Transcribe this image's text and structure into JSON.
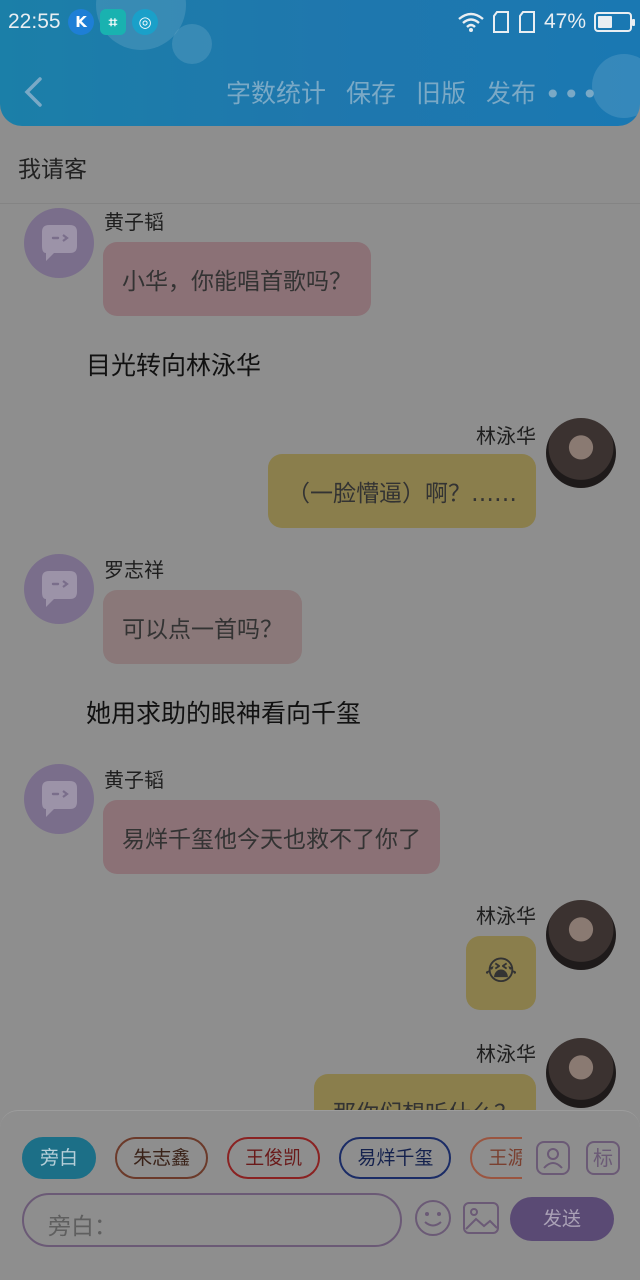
{
  "status_bar": {
    "time": "22:55",
    "battery": "47%",
    "battery_level": 0.47
  },
  "nav": {
    "actions": [
      "字数统计",
      "保存",
      "旧版",
      "发布"
    ],
    "more": "•••"
  },
  "title": "我请客",
  "messages": [
    {
      "type": "left",
      "name": "黄子韬",
      "text": "小华，你能唱首歌吗？",
      "color": "pink"
    },
    {
      "type": "narration",
      "text": "目光转向林泳华"
    },
    {
      "type": "right",
      "name": "林泳华",
      "text": "（一脸懵逼）啊？……",
      "color": "yellow"
    },
    {
      "type": "left",
      "name": "罗志祥",
      "text": "可以点一首吗？",
      "color": "tan"
    },
    {
      "type": "narration",
      "text": "她用求助的眼神看向千玺"
    },
    {
      "type": "left",
      "name": "黄子韬",
      "text": "易烊千玺他今天也救不了你了",
      "color": "pink"
    },
    {
      "type": "right",
      "name": "林泳华",
      "emoji": "😭",
      "color": "yellow"
    },
    {
      "type": "right",
      "name": "林泳华",
      "text": "那你们想听什么？",
      "color": "yellow"
    }
  ],
  "panel": {
    "chips": [
      {
        "label": "旁白",
        "active": true
      },
      {
        "label": "朱志鑫",
        "color": "#6b3a2a"
      },
      {
        "label": "王俊凯",
        "color": "#8a2222"
      },
      {
        "label": "易烊千玺",
        "color": "#1b2c66"
      },
      {
        "label": "王源",
        "color": "#9a5540"
      }
    ],
    "tool_icons": [
      "person-icon",
      "tag-icon"
    ],
    "tag_label": "标",
    "input_placeholder": "旁白：",
    "send_label": "发送"
  }
}
